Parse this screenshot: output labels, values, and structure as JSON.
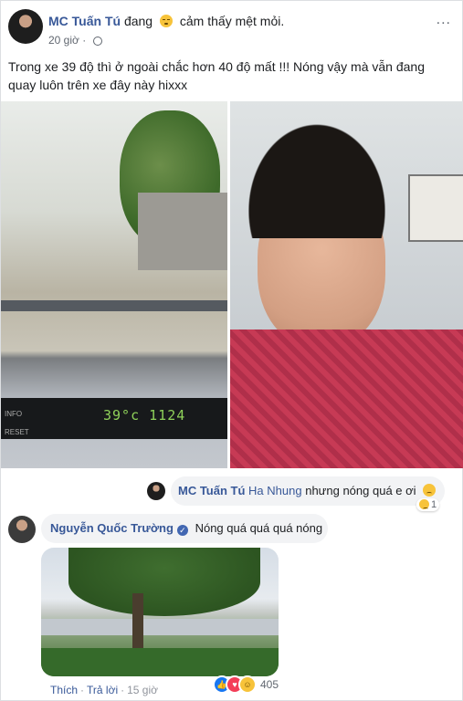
{
  "post": {
    "author": "MC Tuấn Tú",
    "feeling_prefix": "đang",
    "feeling_text": "cảm thấy mệt mỏi.",
    "time": "20 giờ",
    "more": "...",
    "text": "Trong xe 39 độ thì ở ngoài chắc hơn 40 độ mất !!! Nóng vậy mà vẫn đang quay luôn trên xe đây này hixxx",
    "dashboard": {
      "temp": "39°c",
      "clock": "1124",
      "info": "INFO",
      "reset": "RESET"
    }
  },
  "reply": {
    "author": "MC Tuấn Tú",
    "tag": "Ha Nhung",
    "text": "nhưng nóng quá e ơi",
    "reaction_count": "1"
  },
  "comment": {
    "author": "Nguyễn Quốc Trường",
    "text": "Nóng quá quá quá nóng",
    "actions": {
      "like": "Thích",
      "reply": "Trả lời",
      "time": "15 giờ"
    },
    "reaction_count": "405"
  }
}
